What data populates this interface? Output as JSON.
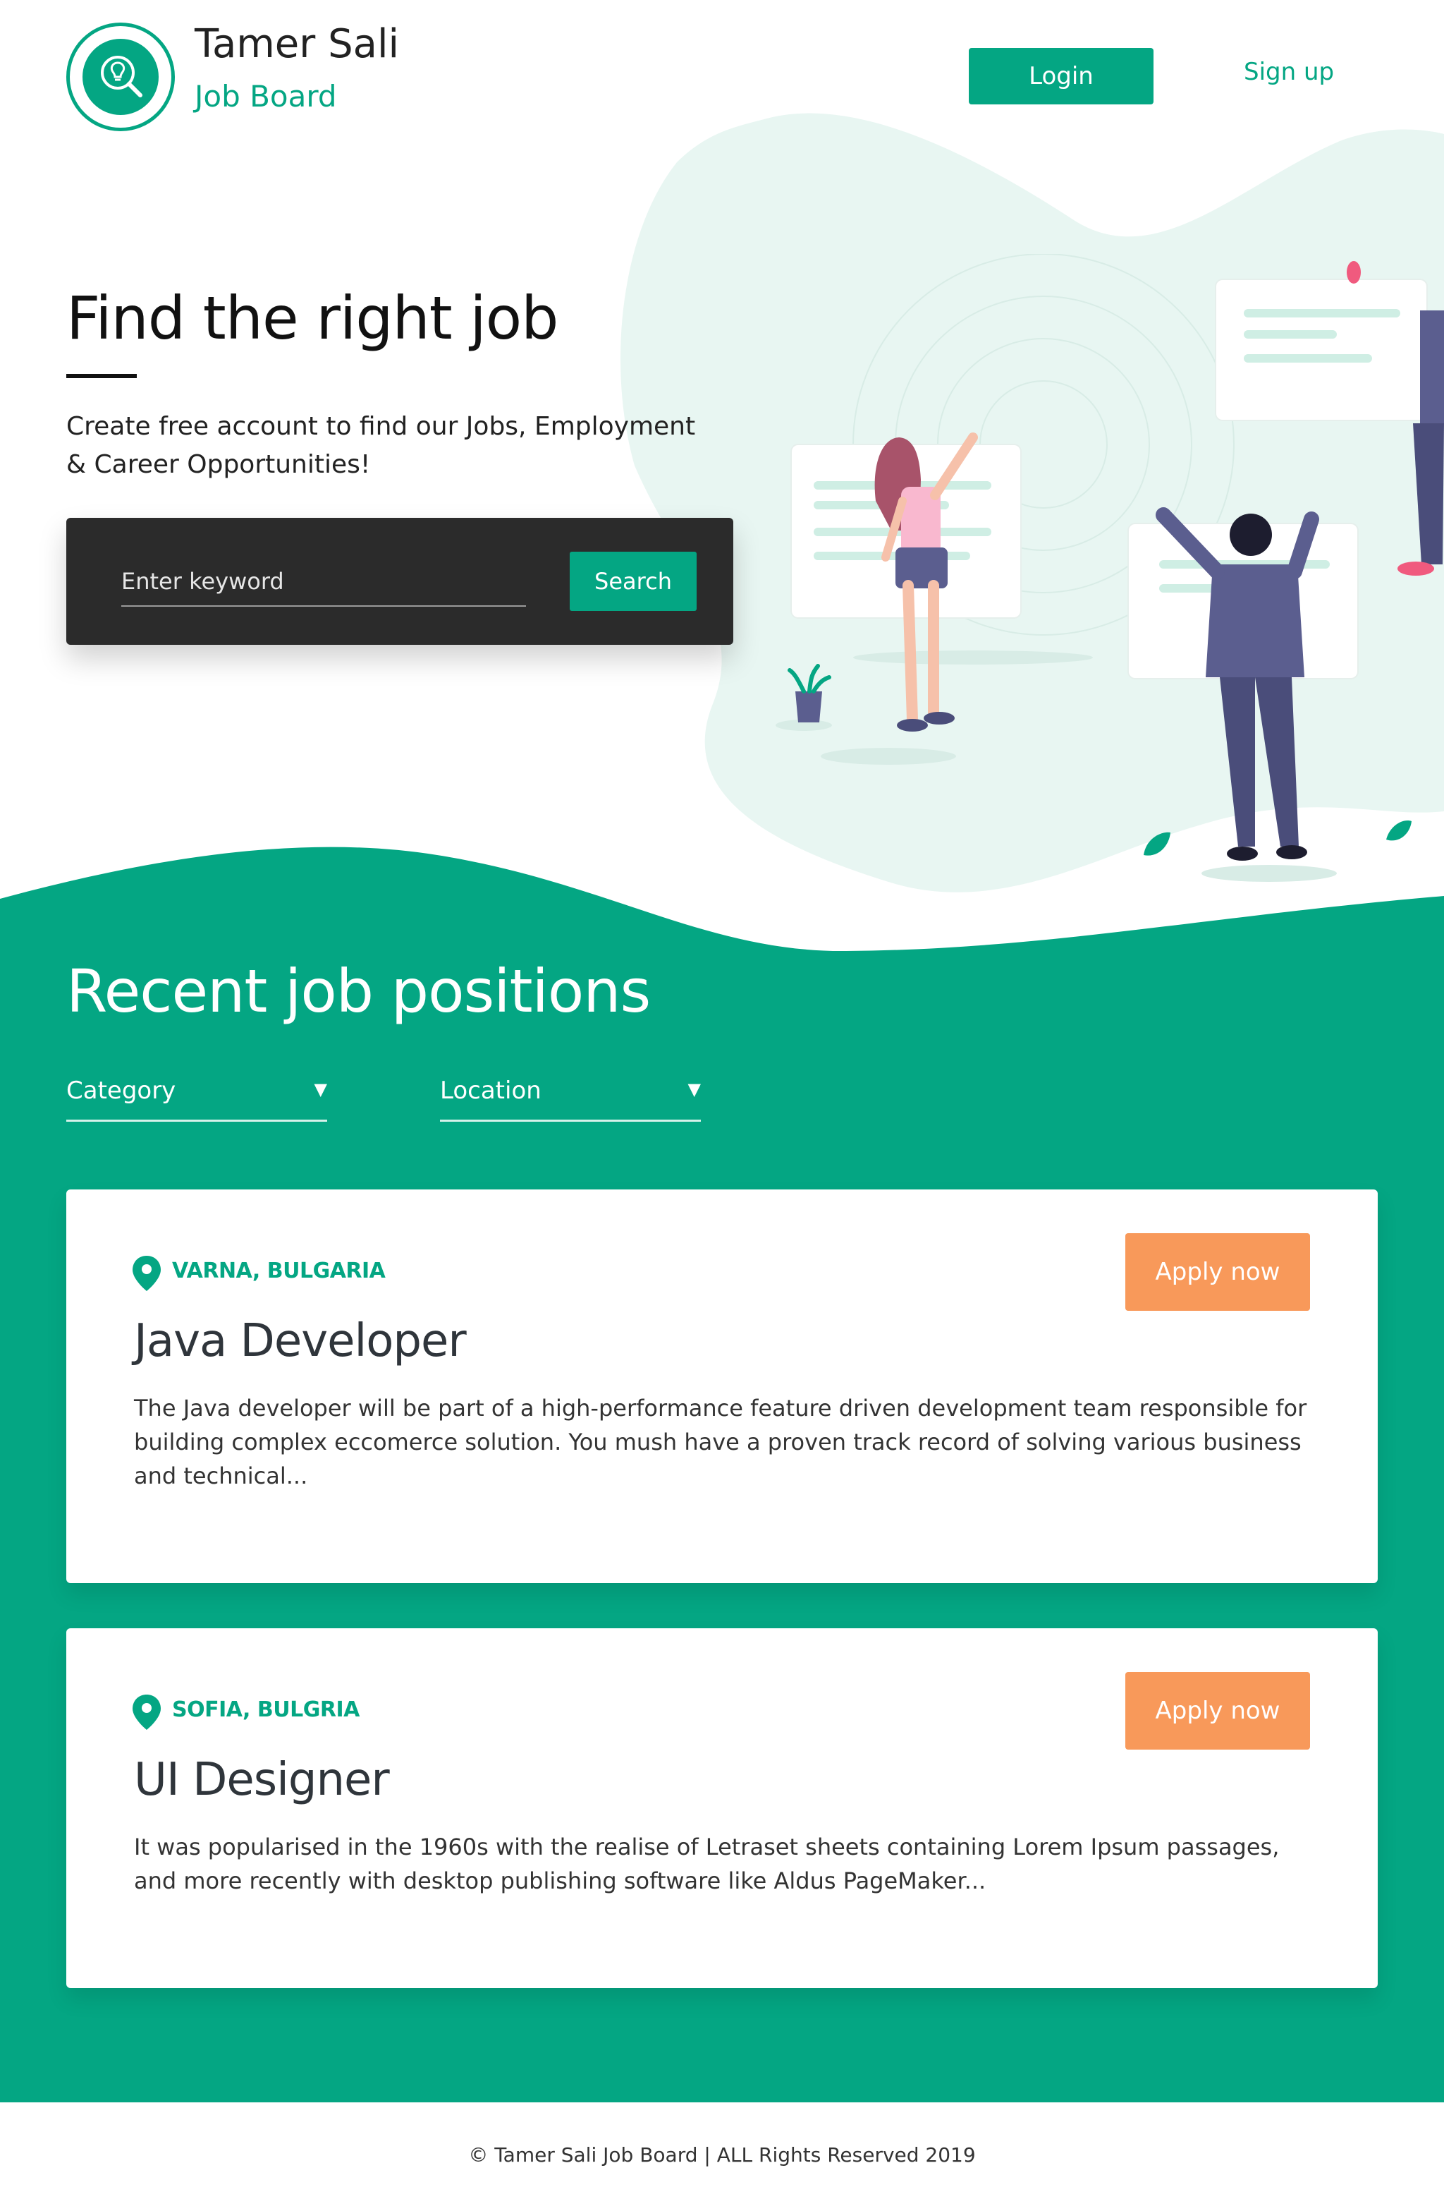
{
  "brand": {
    "name": "Tamer Sali",
    "subtitle": "Job Board",
    "logo_icon": "lightbulb-search-icon"
  },
  "nav": {
    "login_label": "Login",
    "signup_label": "Sign up"
  },
  "hero": {
    "title": "Find the right job",
    "subtitle": "Create free account to find our Jobs, Employment & Career Opportunities!",
    "search": {
      "placeholder": "Enter keyword",
      "button_label": "Search"
    }
  },
  "recent": {
    "title": "Recent job positions",
    "filters": [
      {
        "label": "Category",
        "icon": "caret-down-icon"
      },
      {
        "label": "Location",
        "icon": "caret-down-icon"
      }
    ],
    "jobs": [
      {
        "location": "VARNA, BULGARIA",
        "title": "Java Developer",
        "description": "The Java developer will be part of a high-performance feature driven development team responsible for building complex eccomerce solution. You mush have a proven track record of solving various business and technical...",
        "apply_label": "Apply now"
      },
      {
        "location": "SOFIA, BULGRIA",
        "title": "UI Designer",
        "description": "It was popularised in the 1960s with the realise of Letraset sheets containing Lorem Ipsum passages, and more recently with desktop publishing software like Aldus PageMaker...",
        "apply_label": "Apply now"
      }
    ]
  },
  "footer": {
    "text": "© Tamer Sali Job Board | ALL Rights Reserved 2019"
  },
  "colors": {
    "primary": "#04a683",
    "accent": "#f8995a",
    "dark": "#2b2b2b",
    "blob": "#e8f6f2"
  }
}
